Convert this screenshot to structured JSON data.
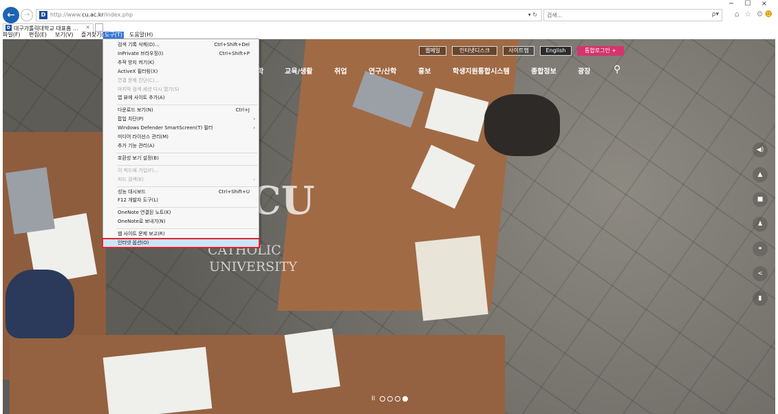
{
  "browser": {
    "address_url_prefix": "http://www.",
    "address_url_domain": "cu.ac.kr",
    "address_url_suffix": "/index.php",
    "favicon_letter": "D",
    "refresh_label": "▾ ↻",
    "search_placeholder": "검색...",
    "search_icon": "ρ▾",
    "tab_title": "대구가톨릭대학교 대표홈 ...",
    "tab_close": "×",
    "window_controls": [
      "−",
      "☐",
      "×"
    ],
    "toolbar_icons": "⌂ ☆ ⚙",
    "smiley": "☻"
  },
  "menubar": [
    {
      "label": "파일(F)"
    },
    {
      "label": "편집(E)"
    },
    {
      "label": "보기(V)"
    },
    {
      "label": "즐겨찾기(A)"
    },
    {
      "label": "도구(T)",
      "active": true
    },
    {
      "label": "도움말(H)"
    }
  ],
  "tools_menu": {
    "items": [
      {
        "label": "검색 기록 삭제(D)...",
        "shortcut": "Ctrl+Shift+Del"
      },
      {
        "label": "InPrivate 브라우징(I)",
        "shortcut": "Ctrl+Shift+P"
      },
      {
        "label": "추적 방지 켜기(K)"
      },
      {
        "label": "ActiveX 필터링(X)"
      },
      {
        "label": "연결 문제 진단(C)...",
        "disabled": true
      },
      {
        "label": "마지막 검색 세션 다시 열기(S)",
        "disabled": true
      },
      {
        "label": "앱 뷰에 사이트 추가(A)"
      },
      {
        "label": "다운로드 보기(N)",
        "shortcut": "Ctrl+J",
        "sep_before": true
      },
      {
        "label": "팝업 차단(P)",
        "submenu": true
      },
      {
        "label": "Windows Defender SmartScreen(T) 필터",
        "submenu": true
      },
      {
        "label": "미디어 라이선스 관리(M)"
      },
      {
        "label": "추가 기능 관리(A)"
      },
      {
        "label": "호환성 보기 설정(B)",
        "sep_before": true
      },
      {
        "label": "이 피드에 가입(F)...",
        "disabled": true,
        "sep_before": true
      },
      {
        "label": "피드 검색(E)",
        "disabled": true,
        "submenu": true
      },
      {
        "label": "성능 대시보드",
        "shortcut": "Ctrl+Shift+U",
        "sep_before": true
      },
      {
        "label": "F12 개발자 도구(L)"
      },
      {
        "label": "OneNote 연결된 노트(K)",
        "sep_before": true
      },
      {
        "label": "OneNote로 보내기(N)"
      },
      {
        "label": "웹 사이트 문제 보고(R)",
        "sep_before": true
      },
      {
        "label": "인터넷 옵션(O)",
        "highlighted": true
      }
    ]
  },
  "site": {
    "top_utils": [
      "웹메일",
      "인터넷디스크",
      "사이트맵",
      "English",
      "통합로그인 +"
    ],
    "gnb": [
      "학",
      "교육/생활",
      "취업",
      "연구/산학",
      "홍보",
      "학생지원통합시스템",
      "종합정보",
      "광장"
    ],
    "logo_cu": "CU",
    "logo_catholic": "CATHOLIC",
    "logo_university": "UNIVERSITY",
    "quick_icons": [
      "◀)",
      "▲",
      "■",
      "♟",
      "⚭",
      "<",
      "▮"
    ],
    "pager_pause": "II",
    "pager_total": 4,
    "pager_active_index": 3
  }
}
